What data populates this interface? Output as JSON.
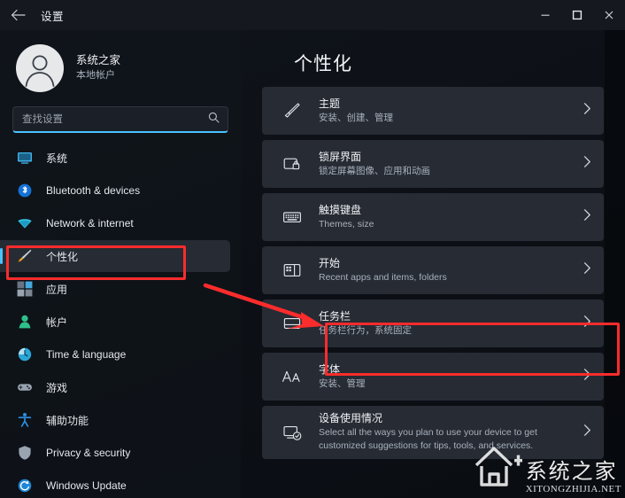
{
  "window": {
    "title": "设置",
    "back_icon": "back-arrow-icon",
    "controls": [
      {
        "name": "minimize-button",
        "icon": "minimize-icon"
      },
      {
        "name": "maximize-button",
        "icon": "maximize-icon"
      },
      {
        "name": "close-button",
        "icon": "close-icon"
      }
    ]
  },
  "sidebar": {
    "profile": {
      "name": "系统之家",
      "sub": "本地帐户",
      "avatar_icon": "user-avatar-icon"
    },
    "search": {
      "placeholder": "查找设置",
      "value": "",
      "icon": "search-icon"
    },
    "items": [
      {
        "label": "系统",
        "icon": "system-icon",
        "selected": false
      },
      {
        "label": "Bluetooth & devices",
        "icon": "bluetooth-icon",
        "selected": false
      },
      {
        "label": "Network & internet",
        "icon": "network-wifi-icon",
        "selected": false
      },
      {
        "label": "个性化",
        "icon": "personalization-brush-icon",
        "selected": true
      },
      {
        "label": "应用",
        "icon": "apps-icon",
        "selected": false
      },
      {
        "label": "帐户",
        "icon": "accounts-icon",
        "selected": false
      },
      {
        "label": "Time & language",
        "icon": "time-language-icon",
        "selected": false
      },
      {
        "label": "游戏",
        "icon": "gaming-icon",
        "selected": false
      },
      {
        "label": "辅助功能",
        "icon": "accessibility-icon",
        "selected": false
      },
      {
        "label": "Privacy & security",
        "icon": "privacy-shield-icon",
        "selected": false
      },
      {
        "label": "Windows Update",
        "icon": "windows-update-icon",
        "selected": false
      }
    ]
  },
  "main": {
    "page_title": "个性化",
    "cards": [
      {
        "title": "主题",
        "sub": "安装、创建、管理",
        "icon": "paintbrush-icon",
        "chevron": "chevron-right-icon",
        "highlighted": false
      },
      {
        "title": "锁屏界面",
        "sub": "锁定屏幕图像、应用和动画",
        "icon": "lock-screen-icon",
        "chevron": "chevron-right-icon",
        "highlighted": false
      },
      {
        "title": "触摸键盘",
        "sub": "Themes, size",
        "icon": "touch-keyboard-icon",
        "chevron": "chevron-right-icon",
        "highlighted": false
      },
      {
        "title": "开始",
        "sub": "Recent apps and items, folders",
        "icon": "start-menu-icon",
        "chevron": "chevron-right-icon",
        "highlighted": false
      },
      {
        "title": "任务栏",
        "sub": "任务栏行为，系统固定",
        "icon": "taskbar-icon",
        "chevron": "chevron-right-icon",
        "highlighted": true
      },
      {
        "title": "字体",
        "sub": "安装、管理",
        "icon": "fonts-aa-icon",
        "chevron": "chevron-right-icon",
        "highlighted": false
      },
      {
        "title": "设备使用情况",
        "sub": "Select all the ways you plan to use your device to get customized suggestions for tips, tools, and services.",
        "icon": "device-usage-icon",
        "chevron": "chevron-right-icon",
        "highlighted": false
      }
    ]
  },
  "annotations": {
    "color": "#fb2c2c",
    "sidebar_highlight_target": "个性化",
    "card_highlight_target": "任务栏",
    "arrow": "red-pointer-arrow"
  },
  "watermark": {
    "cn": "系统之家",
    "en": "XITONGZHIJIA.NET",
    "logo_icon": "house-logo-icon"
  }
}
